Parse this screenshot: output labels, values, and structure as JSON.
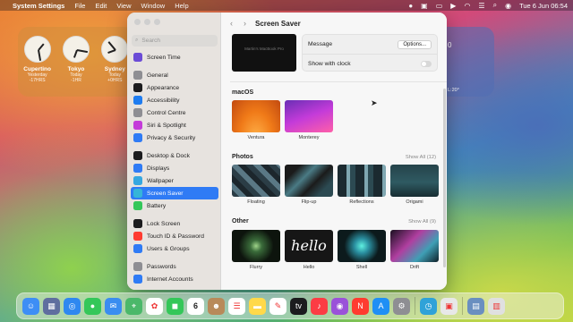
{
  "menubar": {
    "app": "System Settings",
    "items": [
      "File",
      "Edit",
      "View",
      "Window",
      "Help"
    ],
    "datetime": "Tue 6 Jun  06:54"
  },
  "clocks": [
    {
      "city": "Cupertino",
      "day": "Yesterday",
      "offset": "-17HRS"
    },
    {
      "city": "Tokyo",
      "day": "Today",
      "offset": "-1HR"
    },
    {
      "city": "Sydney",
      "day": "Today",
      "offset": "+0HRS"
    }
  ],
  "weather": {
    "temp": "0",
    "range": "L:20°"
  },
  "sidebar": {
    "search_placeholder": "Search",
    "items": [
      {
        "label": "Screen Time",
        "color": "#6b4bd6",
        "icon": "hourglass-icon"
      },
      {
        "label": "General",
        "color": "#8e8e93",
        "icon": "gear-icon"
      },
      {
        "label": "Appearance",
        "color": "#1c1c1e",
        "icon": "appearance-icon"
      },
      {
        "label": "Accessibility",
        "color": "#1e7cf0",
        "icon": "accessibility-icon"
      },
      {
        "label": "Control Centre",
        "color": "#8e8e93",
        "icon": "control-centre-icon"
      },
      {
        "label": "Siri & Spotlight",
        "color": "#c43bd9",
        "icon": "siri-icon"
      },
      {
        "label": "Privacy & Security",
        "color": "#2f7bf5",
        "icon": "hand-icon"
      },
      {
        "label": "Desktop & Dock",
        "color": "#1c1c1e",
        "icon": "dock-icon"
      },
      {
        "label": "Displays",
        "color": "#2f7bf5",
        "icon": "display-icon"
      },
      {
        "label": "Wallpaper",
        "color": "#35a7e0",
        "icon": "wallpaper-icon"
      },
      {
        "label": "Screen Saver",
        "color": "#35b5d8",
        "icon": "screensaver-icon"
      },
      {
        "label": "Battery",
        "color": "#34c759",
        "icon": "battery-icon"
      },
      {
        "label": "Lock Screen",
        "color": "#1c1c1e",
        "icon": "lock-icon"
      },
      {
        "label": "Touch ID & Password",
        "color": "#ff3b30",
        "icon": "fingerprint-icon"
      },
      {
        "label": "Users & Groups",
        "color": "#2f7bf5",
        "icon": "users-icon"
      },
      {
        "label": "Passwords",
        "color": "#8e8e93",
        "icon": "key-icon"
      },
      {
        "label": "Internet Accounts",
        "color": "#2f7bf5",
        "icon": "at-icon"
      }
    ]
  },
  "pane": {
    "title": "Screen Saver",
    "preview_text": "Martin's MacBook Pro",
    "message_label": "Message",
    "options_button": "Options...",
    "clock_label": "Show with clock",
    "clock_on": false
  },
  "sections": {
    "macos": {
      "title": "macOS",
      "items": [
        "Ventura",
        "Monterey"
      ]
    },
    "photos": {
      "title": "Photos",
      "show_all": "Show All (12)",
      "items": [
        "Floating",
        "Flip-up",
        "Reflections",
        "Origami"
      ]
    },
    "other": {
      "title": "Other",
      "show_all": "Show All (9)",
      "items": [
        "Flurry",
        "Hello",
        "Shell",
        "Drift"
      ]
    }
  },
  "dock": {
    "icons": [
      "finder-icon",
      "launchpad-icon",
      "safari-icon",
      "messages-icon",
      "mail-icon",
      "maps-icon",
      "photos-icon",
      "facetime-icon",
      "calendar-icon",
      "contacts-icon",
      "reminders-icon",
      "notes-icon",
      "freeform-icon",
      "tv-icon",
      "music-icon",
      "podcasts-icon",
      "news-icon",
      "appstore-icon",
      "system-settings-icon",
      "time-machine-icon",
      "preview-icon",
      "downloads-icon",
      "trash-icon"
    ],
    "calendar_day": "6"
  }
}
